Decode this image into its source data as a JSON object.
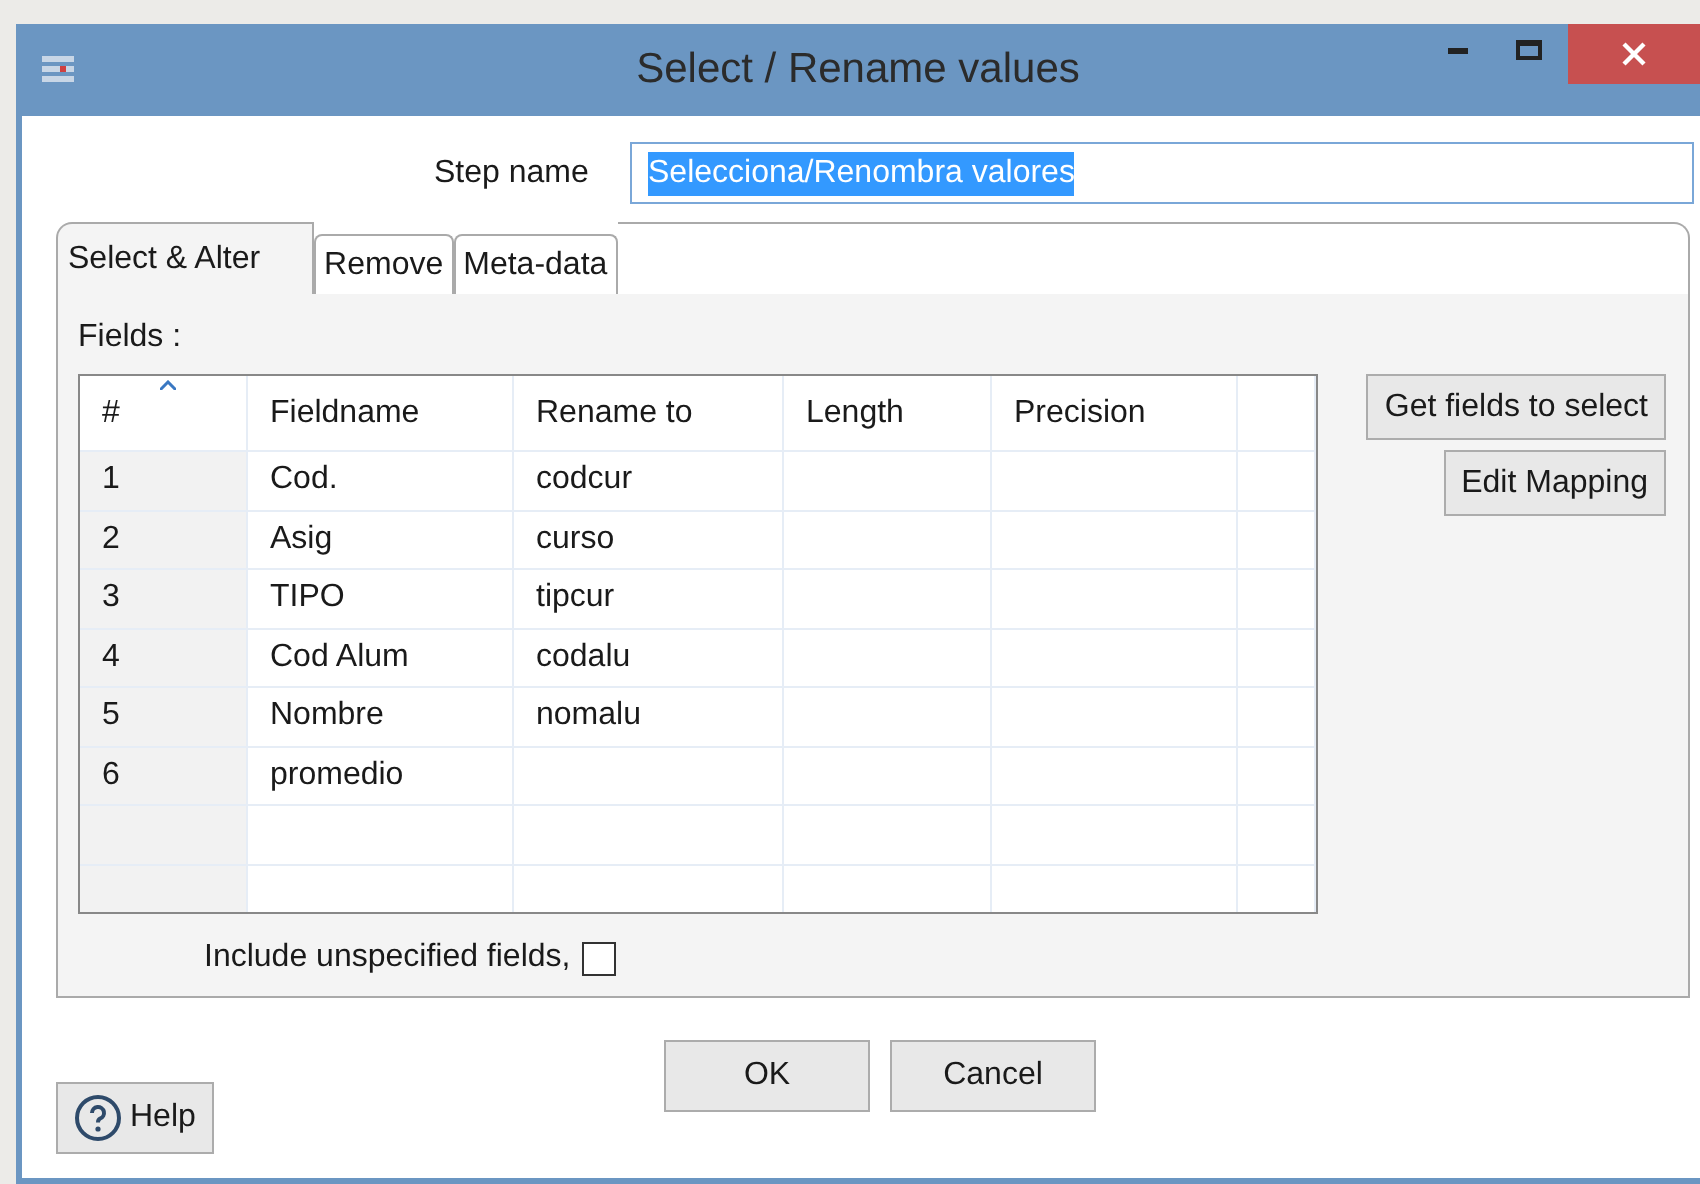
{
  "window": {
    "title": "Select / Rename values"
  },
  "step_name": {
    "label": "Step name",
    "value": "Selecciona/Renombra valores"
  },
  "tabs": [
    {
      "label": "Select & Alter",
      "selected": true
    },
    {
      "label": "Remove",
      "selected": false
    },
    {
      "label": "Meta-data",
      "selected": false
    }
  ],
  "fields_label": "Fields :",
  "table": {
    "columns": [
      "#",
      "Fieldname",
      "Rename to",
      "Length",
      "Precision"
    ],
    "rows": [
      [
        "1",
        "Cod.",
        "codcur",
        "",
        ""
      ],
      [
        "2",
        "Asig",
        "curso",
        "",
        ""
      ],
      [
        "3",
        "TIPO",
        "tipcur",
        "",
        ""
      ],
      [
        "4",
        "Cod Alum",
        "codalu",
        "",
        ""
      ],
      [
        "5",
        "Nombre",
        "nomalu",
        "",
        ""
      ],
      [
        "6",
        "promedio",
        "",
        "",
        ""
      ],
      [
        "",
        "",
        "",
        "",
        ""
      ],
      [
        "",
        "",
        "",
        "",
        ""
      ]
    ]
  },
  "side_buttons": [
    "Get fields to select",
    "Edit Mapping"
  ],
  "include_unspecified": {
    "label": "Include unspecified fields,",
    "checked": false
  },
  "buttons": [
    "OK",
    "Cancel"
  ],
  "help_button": "Help"
}
